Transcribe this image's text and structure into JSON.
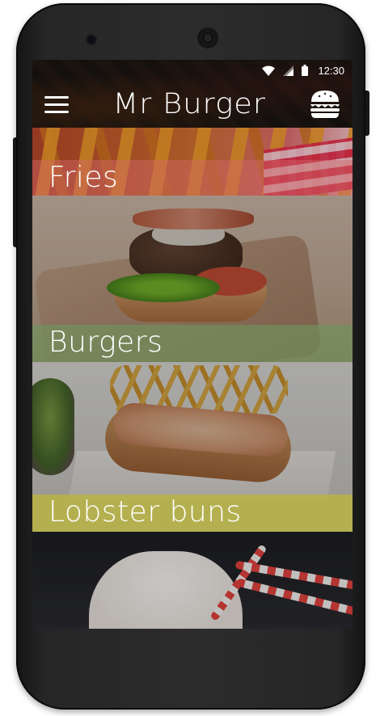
{
  "status_bar": {
    "time": "12:30"
  },
  "app_bar": {
    "title": "Mr Burger"
  },
  "categories": [
    {
      "label": "Fries",
      "band_color": "#d4676a"
    },
    {
      "label": "Burgers",
      "band_color": "#7ea26a"
    },
    {
      "label": "Lobster buns",
      "band_color": "#b8b444"
    }
  ],
  "icons": {
    "menu": "hamburger-menu-icon",
    "logo": "burger-icon",
    "wifi": "wifi-icon",
    "signal": "signal-icon",
    "battery": "battery-icon"
  }
}
